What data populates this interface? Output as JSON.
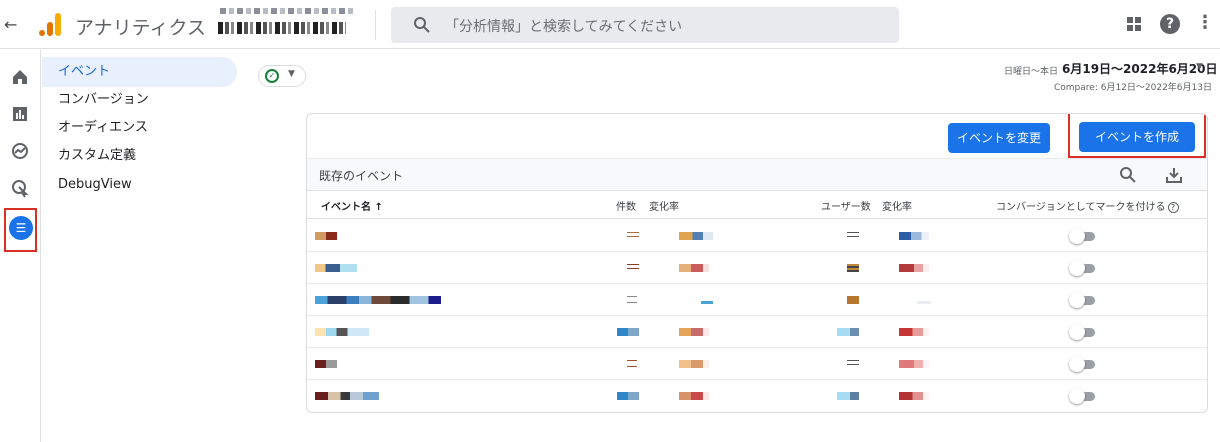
{
  "header": {
    "back_glyph": "←",
    "app_title": "アナリティクス",
    "search_placeholder": "「分析情報」と検索してみてください"
  },
  "nav": {
    "items": [
      {
        "label": "イベント",
        "active": true
      },
      {
        "label": "コンバージョン",
        "active": false
      },
      {
        "label": "オーディエンス",
        "active": false
      },
      {
        "label": "カスタム定義",
        "active": false
      },
      {
        "label": "DebugView",
        "active": false
      }
    ]
  },
  "dates": {
    "label": "日曜日～本日",
    "range": "6月19日～2022年6月20日",
    "compare": "Compare: 6月12日～2022年6月13日"
  },
  "card": {
    "modify_button": "イベントを変更",
    "create_button": "イベントを作成",
    "section_title": "既存のイベント",
    "columns": {
      "event_name": "イベント名 ↑",
      "count": "件数",
      "count_change": "変化率",
      "users": "ユーザー数",
      "users_change": "変化率",
      "conversion": "コンバージョンとしてマークを付ける"
    },
    "rows": [
      {
        "conversion": false
      },
      {
        "conversion": false
      },
      {
        "conversion": false
      },
      {
        "conversion": false
      },
      {
        "conversion": false
      },
      {
        "conversion": false
      }
    ]
  },
  "colors": {
    "accent": "#1a73e8",
    "highlight_border": "#d93025",
    "logo_orange": "#e37400",
    "logo_yellow": "#f9ab00"
  }
}
